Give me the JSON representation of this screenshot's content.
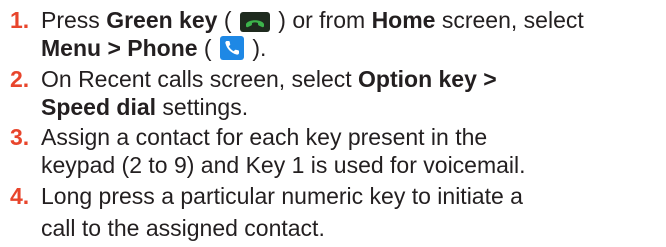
{
  "steps": [
    {
      "number": "1.",
      "lines": [
        {
          "parts": [
            {
              "t": "Press "
            },
            {
              "t": "Green key",
              "b": true
            },
            {
              "t": " ( "
            },
            {
              "icon": "green-call-key-icon"
            },
            {
              "t": " ) or from "
            },
            {
              "t": "Home",
              "b": true
            },
            {
              "t": " screen, select"
            }
          ]
        },
        {
          "parts": [
            {
              "t": "Menu > Phone",
              "b": true
            },
            {
              "t": " ( "
            },
            {
              "icon": "phone-app-icon"
            },
            {
              "t": " )."
            }
          ]
        }
      ]
    },
    {
      "number": "2.",
      "lines": [
        {
          "parts": [
            {
              "t": "On Recent calls screen, select "
            },
            {
              "t": "Option key >",
              "b": true
            }
          ]
        },
        {
          "parts": [
            {
              "t": "Speed dial",
              "b": true
            },
            {
              "t": " settings."
            }
          ]
        }
      ]
    },
    {
      "number": "3.",
      "lines": [
        {
          "parts": [
            {
              "t": "Assign a contact for each key present in the"
            }
          ]
        },
        {
          "parts": [
            {
              "t": "keypad (2 to 9) and Key 1 is used for voicemail."
            }
          ]
        }
      ]
    },
    {
      "number": "4.",
      "lines": [
        {
          "parts": [
            {
              "t": "Long press a particular numeric key to initiate a"
            }
          ]
        },
        {
          "parts": [
            {
              "t": "call to the assigned contact."
            }
          ]
        }
      ]
    }
  ],
  "colors": {
    "step_number": "#e8452c",
    "body_text": "#231f20",
    "green_key_bg": "#1e2a1e",
    "green_key_handset": "#3cb44b",
    "phone_app_bg": "#1e88e5"
  }
}
